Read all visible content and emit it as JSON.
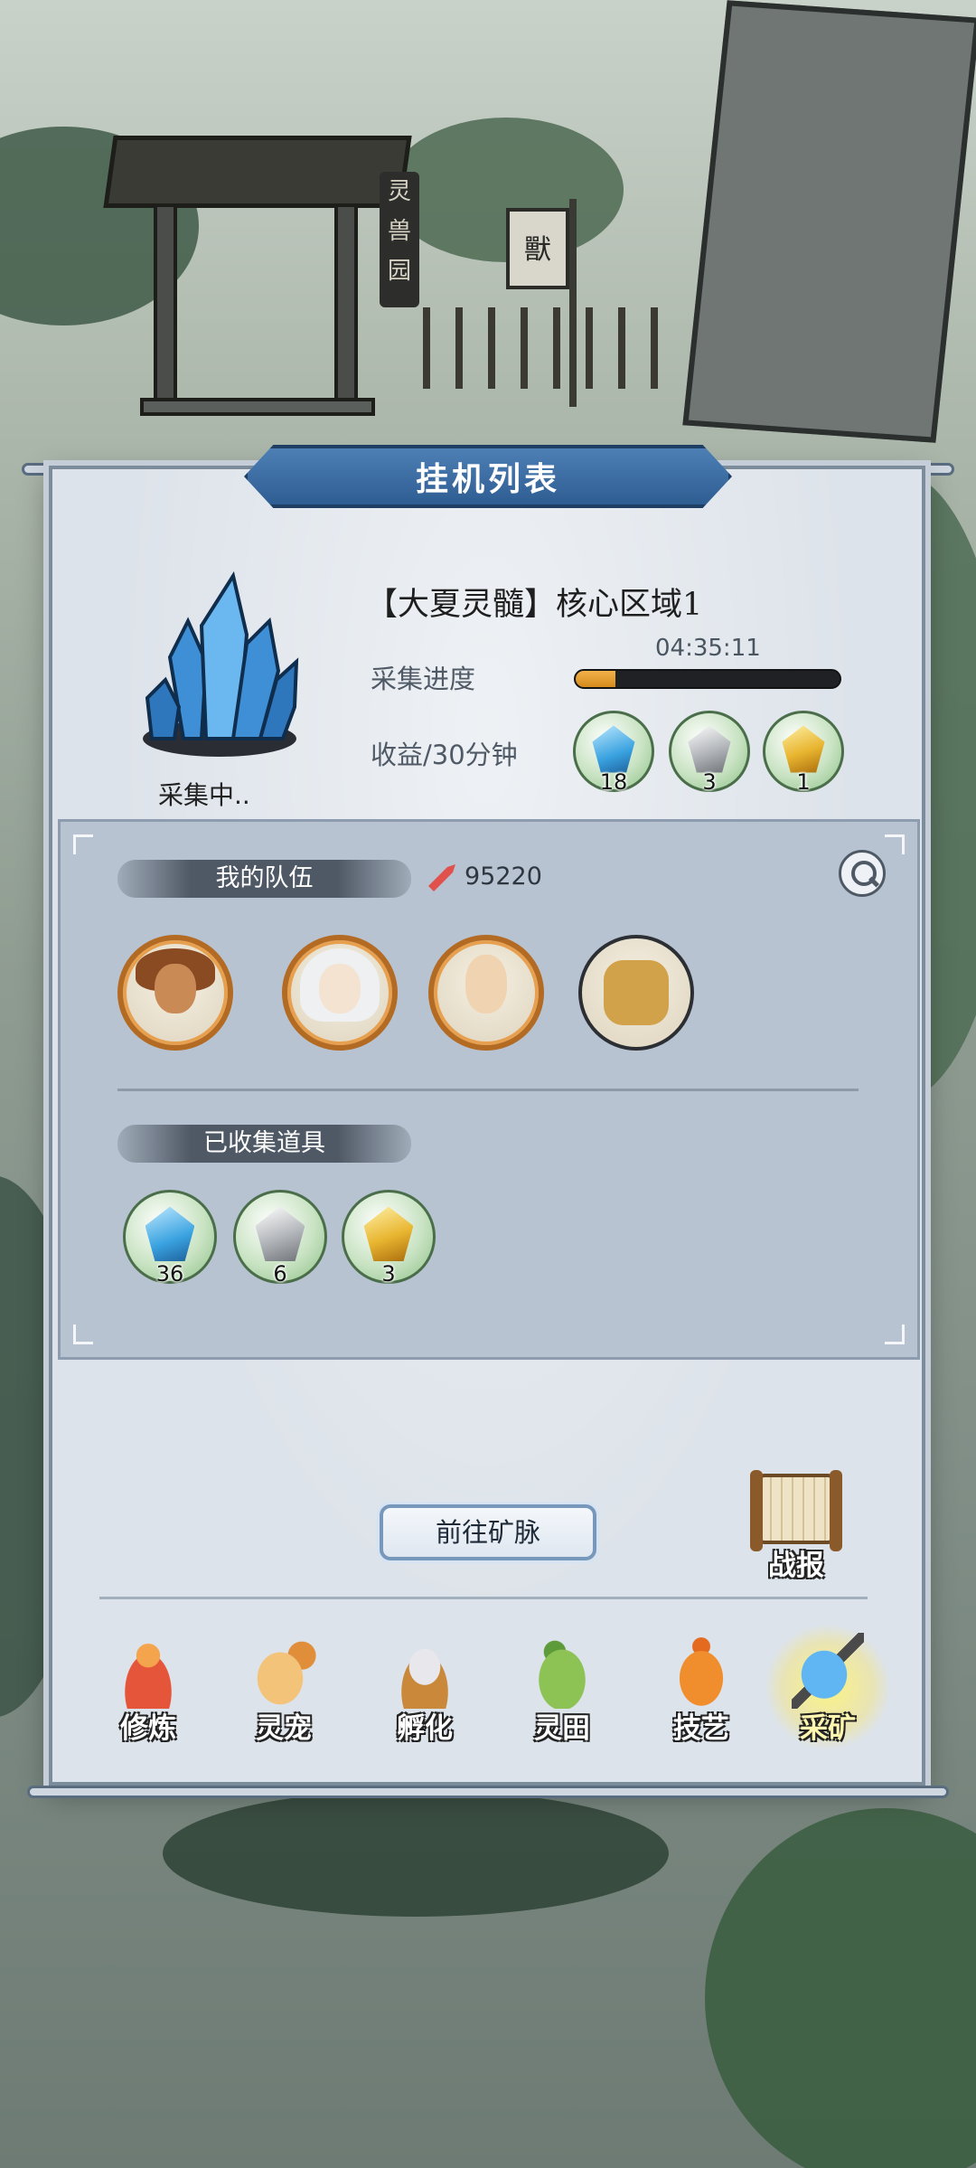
{
  "background": {
    "gate_sign": "灵兽园",
    "flag_text": "獸"
  },
  "panel": {
    "title": "挂机列表"
  },
  "mine": {
    "name": "【大夏灵髓】核心区域1",
    "status": "采集中..",
    "timer": "04:35:11",
    "progress_label": "采集进度",
    "progress": 0.15,
    "income_label": "收益/30分钟",
    "income_items": [
      {
        "icon": "blue-crystal-icon",
        "count": "18"
      },
      {
        "icon": "silver-ore-icon",
        "count": "3"
      },
      {
        "icon": "gold-ore-icon",
        "count": "1"
      }
    ]
  },
  "team": {
    "label": "我的队伍",
    "power": "95220",
    "members": [
      {
        "icon": "monkey-king-avatar"
      },
      {
        "icon": "white-haired-maiden-avatar"
      },
      {
        "icon": "monk-avatar"
      },
      {
        "icon": "golden-dragon-avatar"
      }
    ]
  },
  "collected": {
    "label": "已收集道具",
    "items": [
      {
        "icon": "blue-crystal-icon",
        "count": "36"
      },
      {
        "icon": "silver-ore-icon",
        "count": "6"
      },
      {
        "icon": "gold-ore-icon",
        "count": "3"
      }
    ]
  },
  "actions": {
    "go_label": "前往矿脉",
    "report_label": "战报"
  },
  "nav": [
    {
      "label": "修炼",
      "icon": "meditation-icon",
      "active": false
    },
    {
      "label": "灵宠",
      "icon": "spirit-pet-icon",
      "active": false
    },
    {
      "label": "孵化",
      "icon": "egg-nest-icon",
      "active": false
    },
    {
      "label": "灵田",
      "icon": "spirit-field-icon",
      "active": false
    },
    {
      "label": "技艺",
      "icon": "teapot-icon",
      "active": false
    },
    {
      "label": "采矿",
      "icon": "pickaxe-crystal-icon",
      "active": true
    }
  ],
  "colors": {
    "ribbon": "#2e5d92",
    "progress_fill": "#d58b1b",
    "team_box": "#b7c3d1",
    "active_glow": "#fff078"
  }
}
